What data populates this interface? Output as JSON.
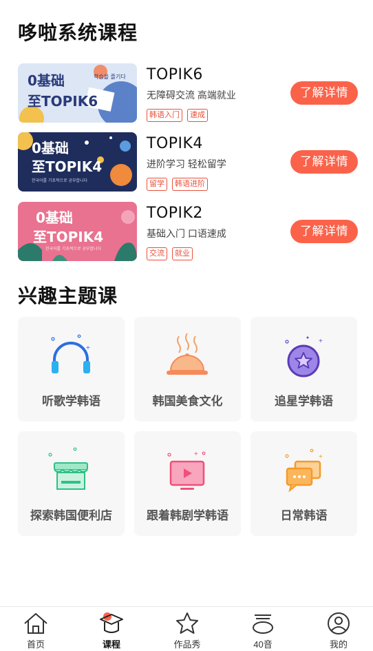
{
  "sections": {
    "system_courses_title": "哆啦系统课程",
    "interest_title": "兴趣主题课"
  },
  "courses": [
    {
      "name": "TOPIK6",
      "desc": "无障碍交流 高端就业",
      "tags": [
        "韩语入门",
        "速成"
      ],
      "button": "了解详情",
      "thumb": {
        "line1": "0基础",
        "line2": "至TOPIK6",
        "korean": "학습을 즐기다"
      }
    },
    {
      "name": "TOPIK4",
      "desc": "进阶学习 轻松留学",
      "tags": [
        "留学",
        "韩语进阶"
      ],
      "button": "了解详情",
      "thumb": {
        "line1": "0基础",
        "line2": "至TOPIK4",
        "korean": "한국어를 기초적으로 공부합니다"
      }
    },
    {
      "name": "TOPIK2",
      "desc": "基础入门 口语速成",
      "tags": [
        "交流",
        "就业"
      ],
      "button": "了解详情",
      "thumb": {
        "line1": "0基础",
        "line2": "至TOPIK4",
        "korean": "한국어를 기초적으로 공부합니다"
      }
    }
  ],
  "topics": [
    {
      "label": "听歌学韩语",
      "icon": "headphones-icon"
    },
    {
      "label": "韩国美食文化",
      "icon": "food-cloche-icon"
    },
    {
      "label": "追星学韩语",
      "icon": "star-badge-icon"
    },
    {
      "label": "探索韩国便利店",
      "icon": "store-icon"
    },
    {
      "label": "跟着韩剧学韩语",
      "icon": "tv-play-icon"
    },
    {
      "label": "日常韩语",
      "icon": "chat-bubbles-icon"
    }
  ],
  "tabbar": [
    {
      "label": "首页",
      "icon": "home-icon"
    },
    {
      "label": "课程",
      "icon": "graduation-cap-icon",
      "active": true
    },
    {
      "label": "作品秀",
      "icon": "star-icon"
    },
    {
      "label": "40音",
      "icon": "syllable-icon"
    },
    {
      "label": "我的",
      "icon": "profile-icon"
    }
  ],
  "colors": {
    "accent": "#fb624a",
    "tag": "#e8503a",
    "card_bg": "#f7f7f7"
  }
}
